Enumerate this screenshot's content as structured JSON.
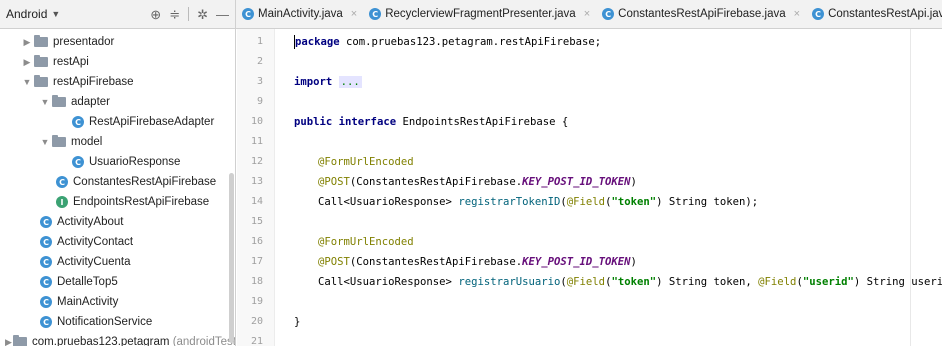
{
  "project_panel": {
    "view_mode": "Android",
    "icons": [
      "globe-icon",
      "collapse-icon",
      "settings-icon",
      "hide-icon"
    ]
  },
  "tabs": [
    {
      "label": "MainActivity.java",
      "icon": "class-icon",
      "closable": true
    },
    {
      "label": "RecyclerviewFragmentPresenter.java",
      "icon": "class-icon",
      "closable": true
    },
    {
      "label": "ConstantesRestApiFirebase.java",
      "icon": "class-icon",
      "closable": true
    },
    {
      "label": "ConstantesRestApi.java",
      "icon": "class-icon",
      "closable": true
    },
    {
      "label": "",
      "icon": "class-icon",
      "closable": false
    }
  ],
  "tree": {
    "items": [
      {
        "label": "presentador",
        "type": "folder",
        "expanded": false
      },
      {
        "label": "restApi",
        "type": "folder",
        "expanded": false
      },
      {
        "label": "restApiFirebase",
        "type": "folder",
        "expanded": true
      },
      {
        "label": "adapter",
        "type": "folder",
        "expanded": true
      },
      {
        "label": "RestApiFirebaseAdapter",
        "type": "class"
      },
      {
        "label": "model",
        "type": "folder",
        "expanded": true
      },
      {
        "label": "UsuarioResponse",
        "type": "class"
      },
      {
        "label": "ConstantesRestApiFirebase",
        "type": "class"
      },
      {
        "label": "EndpointsRestApiFirebase",
        "type": "interface"
      },
      {
        "label": "ActivityAbout",
        "type": "class"
      },
      {
        "label": "ActivityContact",
        "type": "class"
      },
      {
        "label": "ActivityCuenta",
        "type": "class"
      },
      {
        "label": "DetalleTop5",
        "type": "class"
      },
      {
        "label": "MainActivity",
        "type": "class"
      },
      {
        "label": "NotificationService",
        "type": "class"
      },
      {
        "label": "com.pruebas123.petagram",
        "suffix": "(androidTest",
        "type": "folder",
        "expanded": false
      }
    ]
  },
  "gutter": {
    "line_numbers": [
      "1",
      "2",
      "3",
      "9",
      "10",
      "11",
      "12",
      "13",
      "14",
      "15",
      "16",
      "17",
      "18",
      "19",
      "20",
      "21"
    ]
  },
  "code": {
    "package_kw": "package",
    "package_name": " com.pruebas123.petagram.restApiFirebase;",
    "import_kw": "import",
    "import_folded": "...",
    "public_kw": "public",
    "interface_kw": "interface",
    "interface_name": " EndpointsRestApiFirebase {",
    "ann_form": "@FormUrlEncoded",
    "ann_post": "@POST",
    "post_class": "(ConstantesRestApiFirebase.",
    "const_token": "KEY_POST_ID_TOKEN",
    "close_paren": ")",
    "call_type": "Call<UsuarioResponse> ",
    "method1": "registrarTokenID",
    "ann_field": "@Field",
    "str_token": "\"token\"",
    "param_token": ") String token);",
    "method2": "registrarUsuario",
    "param_token2": ") String token, ",
    "str_userid": "\"userid\"",
    "param_userid": ") String userid;",
    "closing_brace": "}"
  }
}
